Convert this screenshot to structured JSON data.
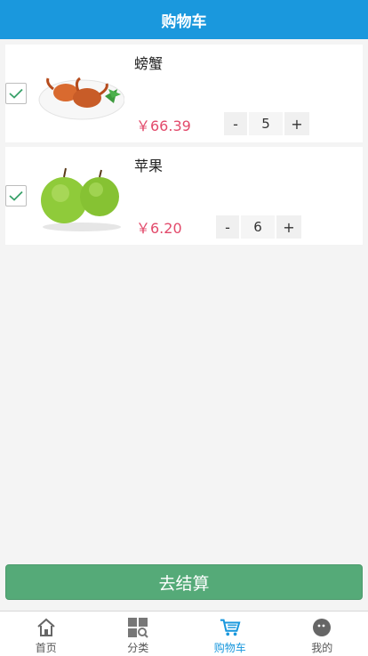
{
  "header": {
    "title": "购物车"
  },
  "cart": {
    "items": [
      {
        "name": "螃蟹",
        "price": "￥66.39",
        "quantity": "5",
        "minus": "-",
        "plus": "+",
        "checked": true
      },
      {
        "name": "苹果",
        "price": "￥6.20",
        "quantity": "6",
        "minus": "-",
        "plus": "+",
        "checked": true
      }
    ],
    "checkout_label": "去结算"
  },
  "tabs": [
    {
      "label": "首页",
      "icon": "home-icon",
      "active": false
    },
    {
      "label": "分类",
      "icon": "category-icon",
      "active": false
    },
    {
      "label": "购物车",
      "icon": "cart-icon",
      "active": true
    },
    {
      "label": "我的",
      "icon": "profile-icon",
      "active": false
    }
  ],
  "colors": {
    "header_bg": "#1a98dd",
    "price": "#e24a6b",
    "checkout_bg": "#55aa78",
    "active_tab": "#1a98dd"
  }
}
